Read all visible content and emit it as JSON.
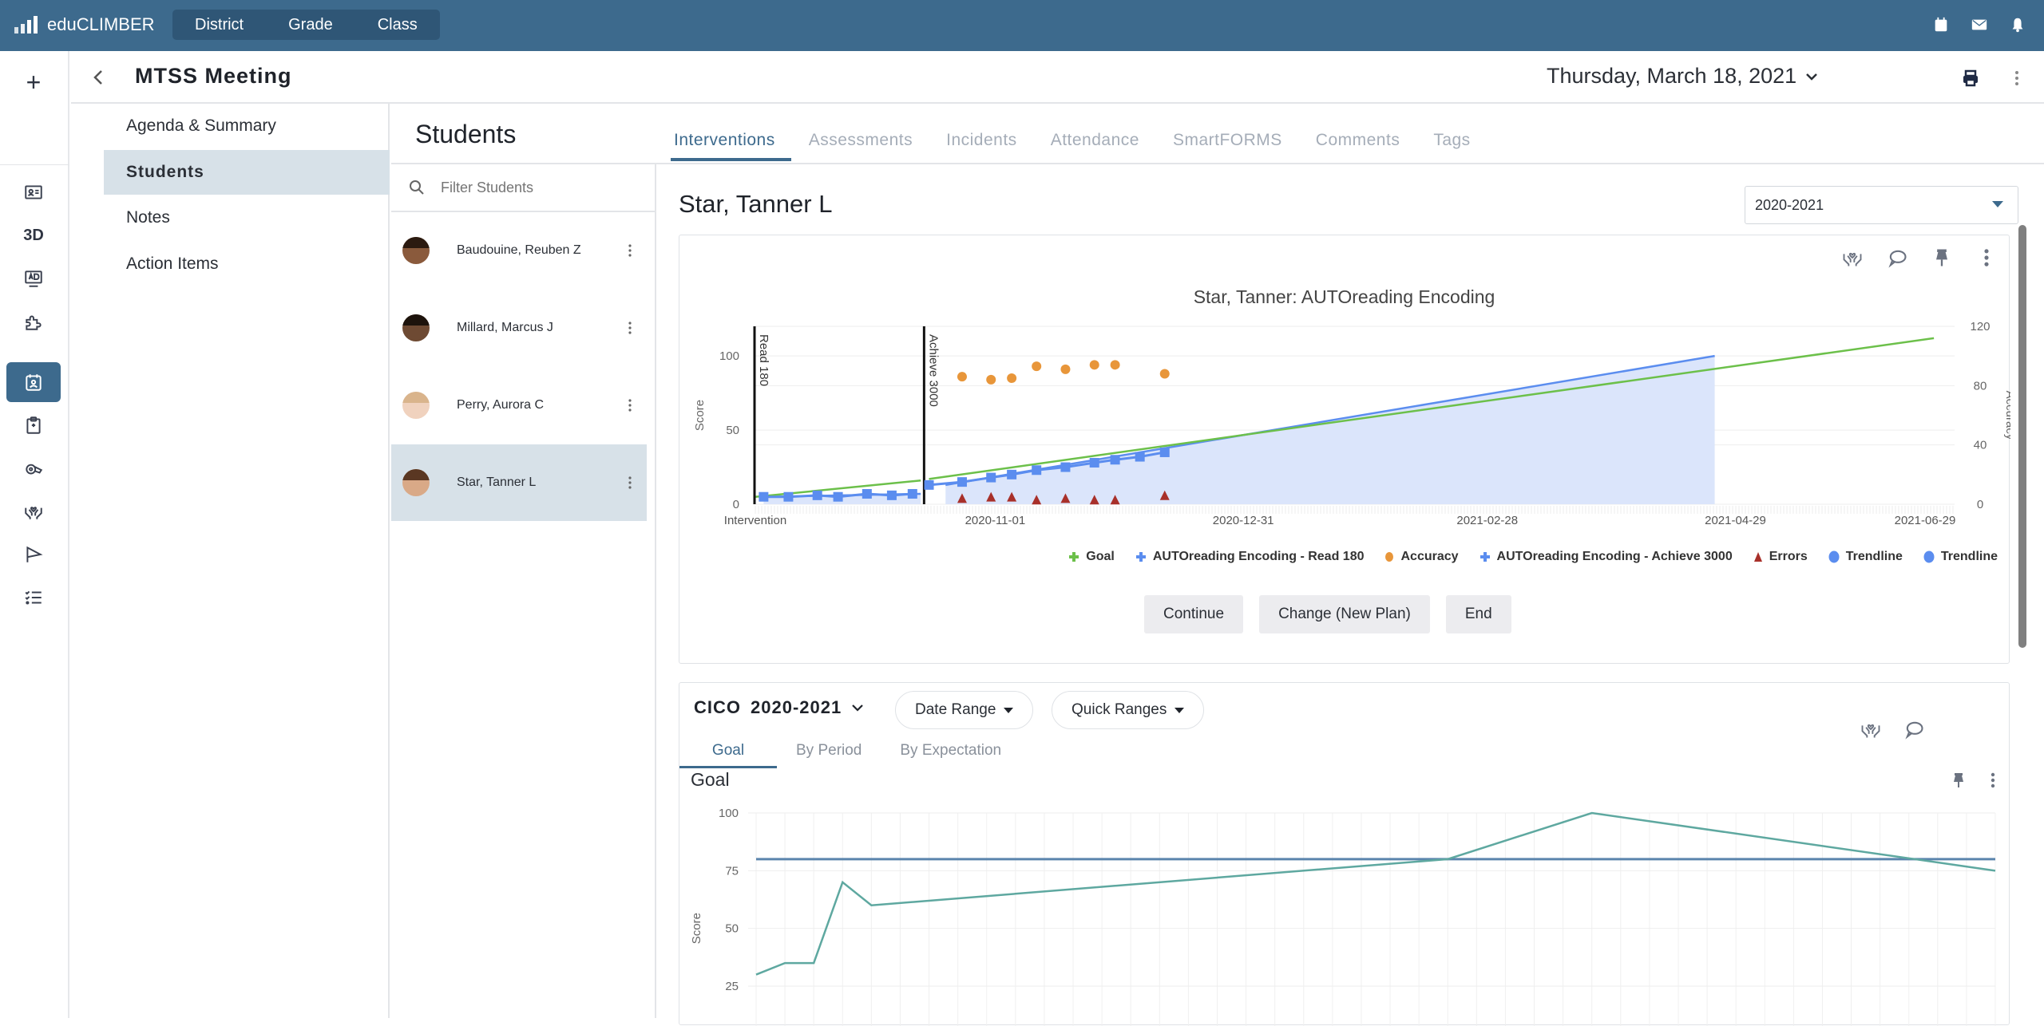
{
  "app": {
    "brand": "eduCLIMBER",
    "scope_tabs": [
      "District",
      "Grade",
      "Class"
    ],
    "top_icons": [
      "calendar-icon",
      "mail-icon",
      "bell-icon"
    ]
  },
  "rail": {
    "add_label": "+",
    "items": [
      {
        "icon": "id-card-icon"
      },
      {
        "label": "3D"
      },
      {
        "icon": "ad-monitor-icon"
      },
      {
        "icon": "puzzle-icon"
      },
      {
        "icon": "calendar-user-icon",
        "active": true
      },
      {
        "icon": "clipboard-icon"
      },
      {
        "icon": "whistle-icon"
      },
      {
        "icon": "care-hands-icon"
      },
      {
        "icon": "flag-icon"
      },
      {
        "icon": "checklist-icon"
      }
    ]
  },
  "header": {
    "back": "<",
    "title": "MTSS Meeting",
    "date": "Thursday, March 18, 2021"
  },
  "left_nav": {
    "items": [
      "Agenda & Summary",
      "Students",
      "Notes",
      "Action Items"
    ],
    "active": "Students"
  },
  "students": {
    "title": "Students",
    "filter_placeholder": "Filter Students",
    "list": [
      {
        "name": "Baudouine, Reuben Z",
        "skin": "#8a5a3c",
        "hair": "#2b1a10"
      },
      {
        "name": "Millard, Marcus J",
        "skin": "#6e4a33",
        "hair": "#1d130c"
      },
      {
        "name": "Perry, Aurora C",
        "skin": "#f0d2be",
        "hair": "#d9b48c"
      },
      {
        "name": "Star, Tanner L",
        "skin": "#d9a987",
        "hair": "#5a3722",
        "active": true
      }
    ]
  },
  "tabs": [
    "Interventions",
    "Assessments",
    "Incidents",
    "Attendance",
    "SmartFORMS",
    "Comments",
    "Tags"
  ],
  "active_tab": "Interventions",
  "detail": {
    "student": "Star, Tanner L",
    "year": "2020-2021",
    "buttons": [
      "Continue",
      "Change (New Plan)",
      "End"
    ]
  },
  "cico": {
    "label": "CICO",
    "year": "2020-2021",
    "date_range": "Date Range",
    "quick_ranges": "Quick Ranges",
    "subtabs": [
      "Goal",
      "By Period",
      "By Expectation"
    ],
    "active_subtab": "Goal",
    "section": "Goal"
  },
  "chart_data": [
    {
      "type": "line",
      "title": "Star, Tanner: AUTOreading Encoding",
      "ylabel": "Score",
      "y2label": "Accuracy",
      "ylim": [
        0,
        120
      ],
      "y_ticks": [
        0,
        50,
        100
      ],
      "y2lim": [
        0,
        120
      ],
      "y2_ticks": [
        0,
        40,
        80,
        120
      ],
      "x_ticks": [
        "Intervention",
        "2020-11-01",
        "2020-12-31",
        "2021-02-28",
        "2021-04-29",
        "2021-06-29"
      ],
      "x_range_days": [
        0,
        290
      ],
      "phase_markers": [
        {
          "label": "Read 180",
          "day": 0
        },
        {
          "label": "Achieve 3000",
          "day": 41
        }
      ],
      "legend": [
        "Goal",
        "AUTOreading Encoding - Read 180",
        "Accuracy",
        "AUTOreading Encoding - Achieve 3000",
        "Errors",
        "Trendline",
        "Trendline"
      ],
      "legend_position": "bottom-right",
      "series": [
        {
          "name": "Goal",
          "color": "#6cc04a",
          "kind": "line",
          "segments": [
            [
              [
                0,
                5
              ],
              [
                40,
                16
              ]
            ],
            [
              [
                42,
                17
              ],
              [
                285,
                112
              ]
            ]
          ]
        },
        {
          "name": "AUTOreading Encoding - Read 180",
          "color": "#5b8def",
          "kind": "line-square",
          "points": [
            [
              2,
              5
            ],
            [
              8,
              5
            ],
            [
              15,
              6
            ],
            [
              20,
              5
            ],
            [
              27,
              7
            ],
            [
              33,
              6
            ],
            [
              38,
              7
            ]
          ]
        },
        {
          "name": "Accuracy",
          "color": "#e8963a",
          "kind": "scatter",
          "axis": "y2",
          "points": [
            [
              50,
              86
            ],
            [
              57,
              84
            ],
            [
              62,
              85
            ],
            [
              68,
              93
            ],
            [
              75,
              91
            ],
            [
              82,
              94
            ],
            [
              87,
              94
            ],
            [
              99,
              88
            ]
          ]
        },
        {
          "name": "AUTOreading Encoding - Achieve 3000",
          "color": "#5b8def",
          "kind": "line-square",
          "points": [
            [
              42,
              13
            ],
            [
              50,
              15
            ],
            [
              57,
              18
            ],
            [
              62,
              20
            ],
            [
              68,
              23
            ],
            [
              75,
              25
            ],
            [
              82,
              28
            ],
            [
              87,
              30
            ],
            [
              93,
              32
            ],
            [
              99,
              35
            ]
          ]
        },
        {
          "name": "Errors",
          "color": "#a8302a",
          "kind": "triangle",
          "points": [
            [
              50,
              3
            ],
            [
              57,
              4
            ],
            [
              62,
              4
            ],
            [
              68,
              2
            ],
            [
              75,
              3
            ],
            [
              82,
              2
            ],
            [
              87,
              2
            ],
            [
              99,
              5
            ]
          ]
        },
        {
          "name": "Trendline",
          "color": "#5b8def",
          "kind": "area",
          "points": [
            [
              2,
              5
            ],
            [
              40,
              7
            ]
          ]
        },
        {
          "name": "Trendline",
          "color": "#5b8def",
          "kind": "area",
          "points": [
            [
              46,
              13
            ],
            [
              232,
              100
            ]
          ]
        }
      ]
    },
    {
      "type": "line",
      "title": "Goal",
      "ylabel": "Score",
      "ylim": [
        20,
        100
      ],
      "y_ticks": [
        25,
        50,
        75,
        100
      ],
      "x_count": 44,
      "series": [
        {
          "name": "Goal line",
          "color": "#5b85ad",
          "values_const": 80
        },
        {
          "name": "Score",
          "color": "#5ea8a0",
          "points": [
            [
              0,
              30
            ],
            [
              1,
              35
            ],
            [
              2,
              35
            ],
            [
              3,
              70
            ],
            [
              4,
              60
            ],
            [
              24,
              80
            ],
            [
              29,
              100
            ],
            [
              43,
              75
            ]
          ]
        }
      ]
    }
  ]
}
